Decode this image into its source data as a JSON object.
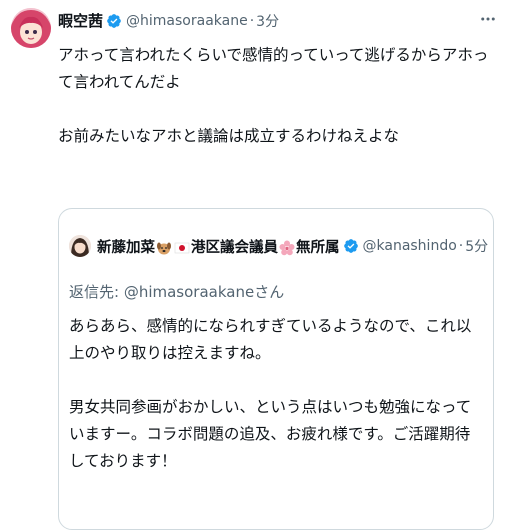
{
  "tweet": {
    "display_name": "暇空茜",
    "handle": "@himasoraakane",
    "separator": "·",
    "time": "3分",
    "paragraphs": [
      "アホって言われたくらいで感情的っていって逃げるからアホって言われてんだよ",
      "お前みたいなアホと議論は成立するわけねえよな"
    ]
  },
  "quoted": {
    "display_name_part1": "新藤加菜",
    "display_name_part2": "港区議会議員",
    "display_name_part3": "無所属",
    "handle": "@kanashindo",
    "separator": "·",
    "time": "5分",
    "reply_prefix": "返信先: ",
    "reply_mention": "@himasoraakane",
    "reply_suffix": "さん",
    "paragraphs": [
      "あらあら、感情的になられすぎているようなので、これ以上のやり取りは控えますね。",
      "男女共同参画がおかしい、という点はいつも勉強になっていますー。コラボ問題の追及、お疲れ様です。ご活躍期待しております！"
    ]
  },
  "icons": {
    "verified": "verified-badge-icon",
    "more": "more-dots-icon",
    "emoji_dog": "dog-face-emoji",
    "emoji_flag": "japan-flag-emoji",
    "emoji_flower": "cherry-blossom-emoji"
  },
  "colors": {
    "text": "#0f1419",
    "secondary": "#536471",
    "verified": "#1d9bf0",
    "border": "#cfd9de"
  }
}
